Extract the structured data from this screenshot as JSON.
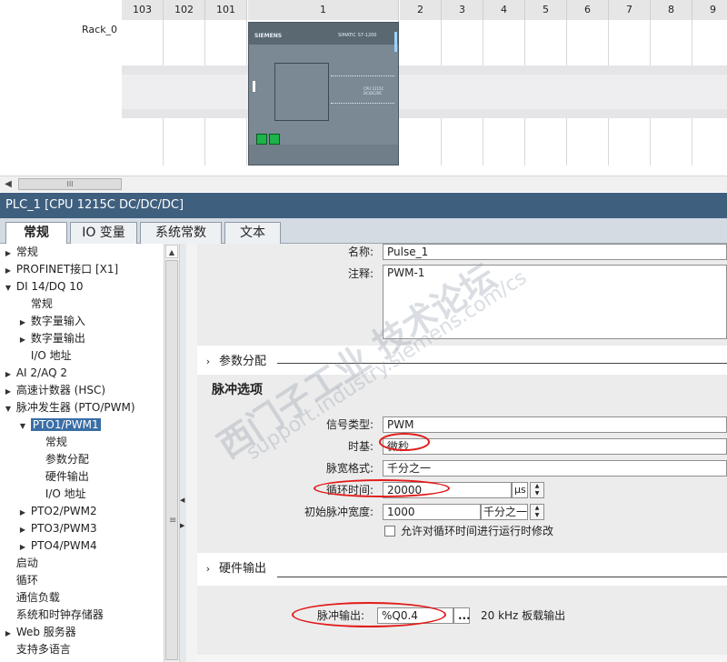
{
  "device_view": {
    "slots": [
      "103",
      "102",
      "101",
      "1",
      "2",
      "3",
      "4",
      "5",
      "6",
      "7",
      "8",
      "9"
    ],
    "rack_label": "Rack_0",
    "cpu_brand": "SIEMENS",
    "cpu_model": "SIMATIC S7-1200",
    "cpu_type": "CPU 1215C DC/DC/DC"
  },
  "scrollbar": {
    "thumb_label": "III"
  },
  "inspector": {
    "title": "PLC_1 [CPU 1215C DC/DC/DC]",
    "tabs": [
      "常规",
      "IO 变量",
      "系统常数",
      "文本"
    ]
  },
  "nav": {
    "items": [
      {
        "label": "常规",
        "level": 0,
        "arrow": "▶"
      },
      {
        "label": "PROFINET接口 [X1]",
        "level": 0,
        "arrow": "▶"
      },
      {
        "label": "DI 14/DQ 10",
        "level": 0,
        "arrow": "▼"
      },
      {
        "label": "常规",
        "level": 1,
        "arrow": ""
      },
      {
        "label": "数字量输入",
        "level": 1,
        "arrow": "▶"
      },
      {
        "label": "数字量输出",
        "level": 1,
        "arrow": "▶"
      },
      {
        "label": "I/O 地址",
        "level": 1,
        "arrow": ""
      },
      {
        "label": "AI 2/AQ 2",
        "level": 0,
        "arrow": "▶"
      },
      {
        "label": "高速计数器 (HSC)",
        "level": 0,
        "arrow": "▶"
      },
      {
        "label": "脉冲发生器 (PTO/PWM)",
        "level": 0,
        "arrow": "▼"
      },
      {
        "label": "PTO1/PWM1",
        "level": 1,
        "arrow": "▼",
        "selected": true
      },
      {
        "label": "常规",
        "level": 2,
        "arrow": ""
      },
      {
        "label": "参数分配",
        "level": 2,
        "arrow": ""
      },
      {
        "label": "硬件输出",
        "level": 2,
        "arrow": ""
      },
      {
        "label": "I/O 地址",
        "level": 2,
        "arrow": ""
      },
      {
        "label": "PTO2/PWM2",
        "level": 1,
        "arrow": "▶"
      },
      {
        "label": "PTO3/PWM3",
        "level": 1,
        "arrow": "▶"
      },
      {
        "label": "PTO4/PWM4",
        "level": 1,
        "arrow": "▶"
      },
      {
        "label": "启动",
        "level": 0,
        "arrow": ""
      },
      {
        "label": "循环",
        "level": 0,
        "arrow": ""
      },
      {
        "label": "通信负载",
        "level": 0,
        "arrow": ""
      },
      {
        "label": "系统和时钟存储器",
        "level": 0,
        "arrow": ""
      },
      {
        "label": "Web 服务器",
        "level": 0,
        "arrow": "▶"
      },
      {
        "label": "支持多语言",
        "level": 0,
        "arrow": ""
      }
    ]
  },
  "general": {
    "name_label": "名称:",
    "name_value": "Pulse_1",
    "comment_label": "注释:",
    "comment_value": "PWM-1"
  },
  "param": {
    "section_title": "参数分配",
    "subsection_title": "脉冲选项",
    "signal_type_label": "信号类型:",
    "signal_type_value": "PWM",
    "time_base_label": "时基:",
    "time_base_value": "微秒",
    "pulse_format_label": "脉宽格式:",
    "pulse_format_value": "千分之一",
    "cycle_time_label": "循环时间:",
    "cycle_time_value": "20000",
    "cycle_time_unit": "µs",
    "initial_pulse_label": "初始脉冲宽度:",
    "initial_pulse_value": "1000",
    "initial_pulse_unit": "千分之一",
    "runtime_modify_label": "允许对循环时间进行运行时修改"
  },
  "hw_output": {
    "section_title": "硬件输出",
    "pulse_output_label": "脉冲输出:",
    "pulse_output_value": "%Q0.4",
    "browse_label": "...",
    "description": "20 kHz 板载输出"
  },
  "watermark": {
    "line1": "西门子工业 技术论坛",
    "line2": "support.industry.siemens.com/cs"
  },
  "icons": {
    "collapsed": "chevron-right-icon",
    "expanded": "chevron-down-icon"
  },
  "colors": {
    "title_bar": "#3f5f7f",
    "selection": "#3a6ea5",
    "annotation": "#e21a1a",
    "port": "#1db34a"
  }
}
